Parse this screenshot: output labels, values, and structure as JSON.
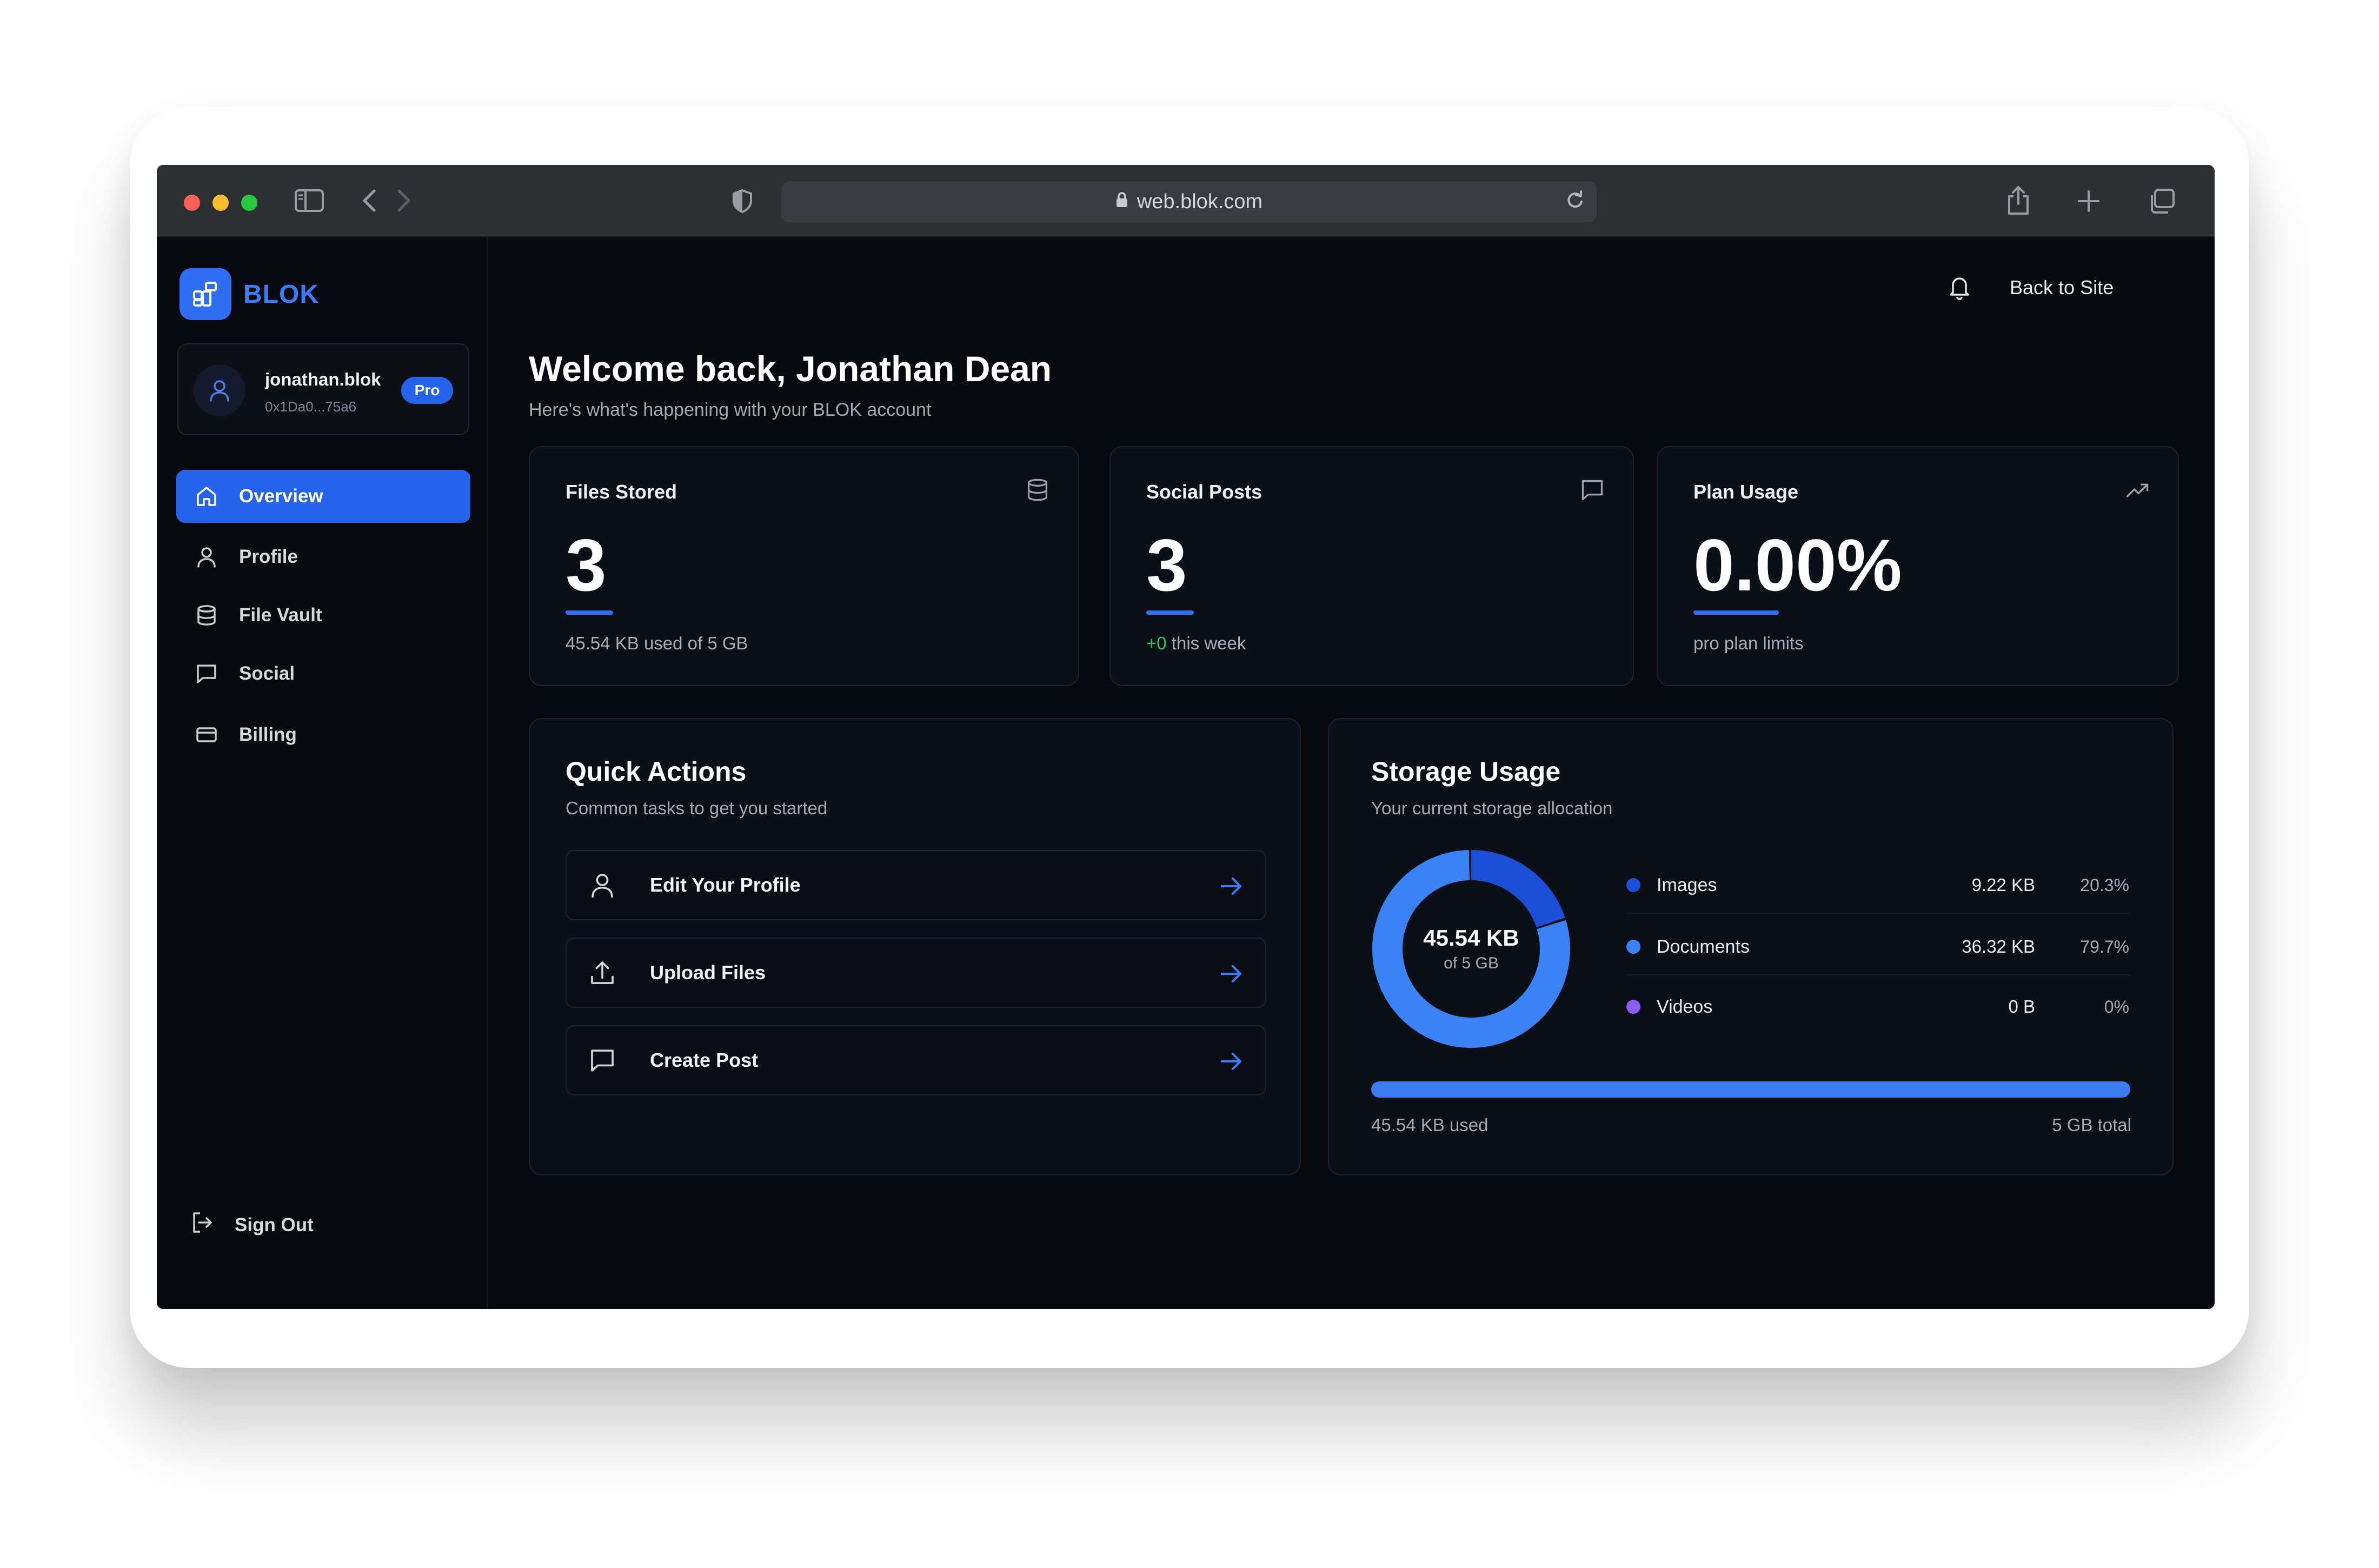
{
  "browser": {
    "url": "web.blok.com"
  },
  "brand": {
    "name": "BLOK",
    "accent": "#2563eb"
  },
  "user": {
    "handle": "jonathan.blok",
    "address": "0x1Da0...75a6",
    "plan_badge": "Pro"
  },
  "sidebar": {
    "items": [
      {
        "label": "Overview",
        "icon": "home-icon",
        "active": true
      },
      {
        "label": "Profile",
        "icon": "user-icon",
        "active": false
      },
      {
        "label": "File Vault",
        "icon": "database-icon",
        "active": false
      },
      {
        "label": "Social",
        "icon": "message-icon",
        "active": false
      },
      {
        "label": "Billing",
        "icon": "credit-card-icon",
        "active": false
      }
    ],
    "sign_out": "Sign Out"
  },
  "topbar": {
    "back_label": "Back to Site"
  },
  "header": {
    "title": "Welcome back, Jonathan Dean",
    "subtitle": "Here's what's happening with your BLOK account"
  },
  "stats": {
    "files": {
      "title": "Files Stored",
      "value": "3",
      "foot": "45.54 KB used of 5 GB"
    },
    "social": {
      "title": "Social Posts",
      "value": "3",
      "delta": "+0",
      "foot": " this week"
    },
    "plan": {
      "title": "Plan Usage",
      "value": "0.00%",
      "foot": "pro plan limits"
    }
  },
  "quick_actions": {
    "title": "Quick Actions",
    "subtitle": "Common tasks to get you started",
    "items": [
      {
        "label": "Edit Your Profile",
        "icon": "user-icon"
      },
      {
        "label": "Upload Files",
        "icon": "upload-icon"
      },
      {
        "label": "Create Post",
        "icon": "message-icon"
      }
    ]
  },
  "storage": {
    "title": "Storage Usage",
    "subtitle": "Your current storage allocation",
    "center_value": "45.54 KB",
    "center_sub": "of 5 GB",
    "breakdown": [
      {
        "name": "Images",
        "size": "9.22 KB",
        "pct": "20.3%",
        "fraction": 0.203,
        "color": "#1d4ed8"
      },
      {
        "name": "Documents",
        "size": "36.32 KB",
        "pct": "79.7%",
        "fraction": 0.797,
        "color": "#3b82f6"
      },
      {
        "name": "Videos",
        "size": "0 B",
        "pct": "0%",
        "fraction": 0,
        "color": "#8b5cf6"
      }
    ],
    "used_label": "45.54 KB used",
    "total_label": "5 GB total",
    "bar_fill_fraction": 1.0
  }
}
